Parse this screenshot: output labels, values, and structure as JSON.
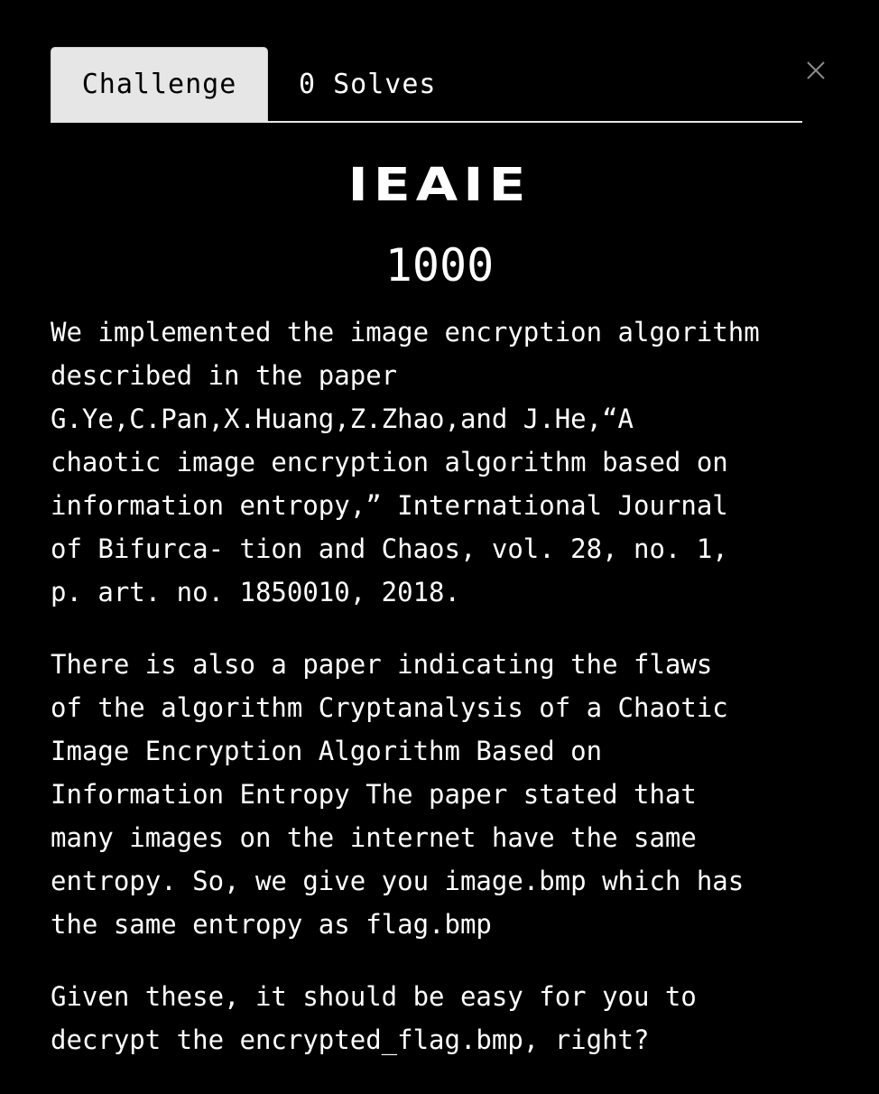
{
  "modal": {
    "close_label": "×",
    "close_icon": "close-icon",
    "tabs": [
      {
        "label": "Challenge",
        "active": true
      },
      {
        "label": "0 Solves",
        "active": false
      }
    ],
    "challenge": {
      "name": "IEAIE",
      "value": "1000"
    },
    "description": {
      "paragraphs": [
        {
          "lines": [
            "We implemented the image encryption algorithm",
            "described in the paper",
            "G.Ye,C.Pan,X.Huang,Z.Zhao,and J.He,“A",
            "chaotic image encryption algorithm based on",
            "information entropy,” International Journal",
            "of Bifurca- tion and Chaos, vol. 28, no. 1,",
            "p. art. no. 1850010, 2018."
          ]
        },
        {
          "lines": [
            "There is also a paper indicating the flaws",
            "of the algorithm Cryptanalysis of a Chaotic",
            "Image Encryption Algorithm Based on",
            "Information Entropy The paper stated that",
            "many images on the internet have the same",
            "entropy. So, we give you image.bmp which has",
            "the same entropy as flag.bmp"
          ]
        },
        {
          "lines": [
            "Given these, it should be easy for you to",
            "decrypt the encrypted_flag.bmp, right?"
          ]
        }
      ]
    }
  },
  "colors": {
    "background": "#000000",
    "text": "#ffffff",
    "tab_active_bg": "#e6e6e6",
    "close_icon": "#8a8a8a"
  }
}
